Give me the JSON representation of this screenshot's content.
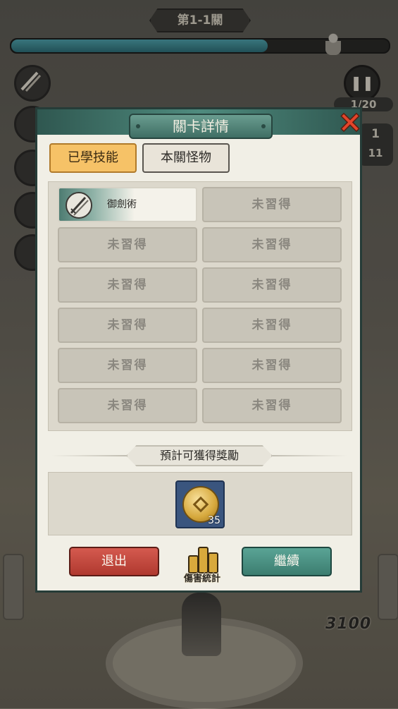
{
  "hud": {
    "stage_title": "第1-1關",
    "stage_progress": 0.68,
    "wave_counter": "1/20",
    "side_counter_top": "1",
    "side_counter_bottom": "11",
    "score": "3100"
  },
  "panel": {
    "title": "關卡詳情",
    "tabs": [
      {
        "label": "已學技能",
        "active": true
      },
      {
        "label": "本關怪物",
        "active": false
      }
    ],
    "skills": [
      {
        "label": "御劍術",
        "learned": true,
        "icon": "crossed-swords-icon"
      },
      {
        "label": "未習得",
        "learned": false
      },
      {
        "label": "未習得",
        "learned": false
      },
      {
        "label": "未習得",
        "learned": false
      },
      {
        "label": "未習得",
        "learned": false
      },
      {
        "label": "未習得",
        "learned": false
      },
      {
        "label": "未習得",
        "learned": false
      },
      {
        "label": "未習得",
        "learned": false
      },
      {
        "label": "未習得",
        "learned": false
      },
      {
        "label": "未習得",
        "learned": false
      },
      {
        "label": "未習得",
        "learned": false
      },
      {
        "label": "未習得",
        "learned": false
      }
    ],
    "reward_title": "預計可獲得獎勵",
    "rewards": [
      {
        "icon": "gold-coin-icon",
        "count": "35"
      }
    ],
    "buttons": {
      "exit": "退出",
      "stats": "傷害統計",
      "continue": "繼續"
    }
  },
  "colors": {
    "accent_teal": "#3c7d70",
    "exit_red": "#b0392f",
    "tab_active": "#f6c267"
  }
}
